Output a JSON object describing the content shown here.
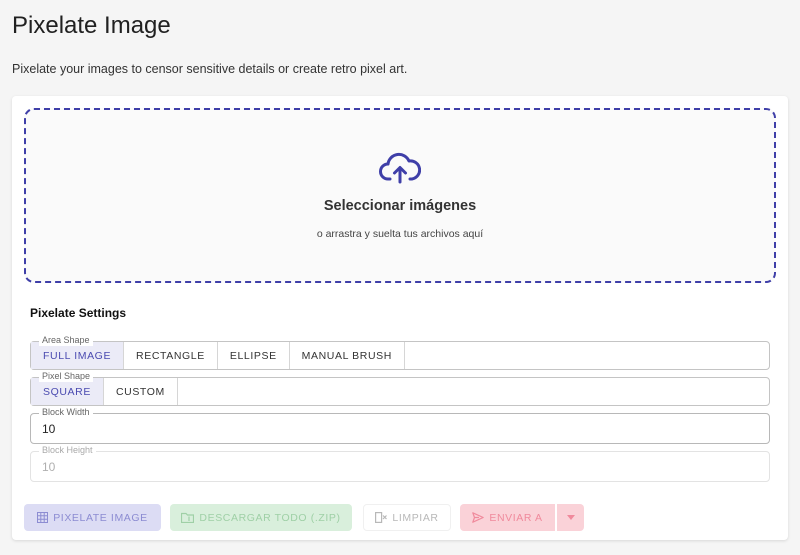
{
  "header": {
    "title": "Pixelate Image",
    "subtitle": "Pixelate your images to censor sensitive details or create retro pixel art."
  },
  "dropzone": {
    "title": "Seleccionar imágenes",
    "subtitle": "o arrastra y suelta tus archivos aquí",
    "icon": "cloud-upload-icon",
    "border_color": "#3f3fa8"
  },
  "settings": {
    "title": "Pixelate Settings",
    "area_shape": {
      "label": "Area Shape",
      "options": [
        "FULL IMAGE",
        "RECTANGLE",
        "ELLIPSE",
        "MANUAL BRUSH"
      ],
      "selected": "FULL IMAGE"
    },
    "pixel_shape": {
      "label": "Pixel Shape",
      "options": [
        "SQUARE",
        "CUSTOM"
      ],
      "selected": "SQUARE"
    },
    "block_width": {
      "label": "Block Width",
      "value": "10"
    },
    "block_height": {
      "label": "Block Height",
      "value": "10",
      "disabled": true
    }
  },
  "actions": {
    "pixelate": {
      "label": "PIXELATE IMAGE",
      "icon": "grid-icon",
      "enabled": false
    },
    "download": {
      "label": "DESCARGAR TODO (.ZIP)",
      "icon": "folder-zip-icon",
      "enabled": false
    },
    "clear": {
      "label": "LIMPIAR",
      "icon": "clear-icon",
      "enabled": false
    },
    "send": {
      "label": "ENVIAR A",
      "icon": "send-icon",
      "enabled": false
    },
    "send_menu": {
      "icon": "caret-down-icon"
    }
  },
  "colors": {
    "accent": "#4a4ab0",
    "pixelate_button_bg": "#dcdcf4",
    "download_button_bg": "#d9efdc",
    "send_button_bg": "#fad2d8"
  }
}
